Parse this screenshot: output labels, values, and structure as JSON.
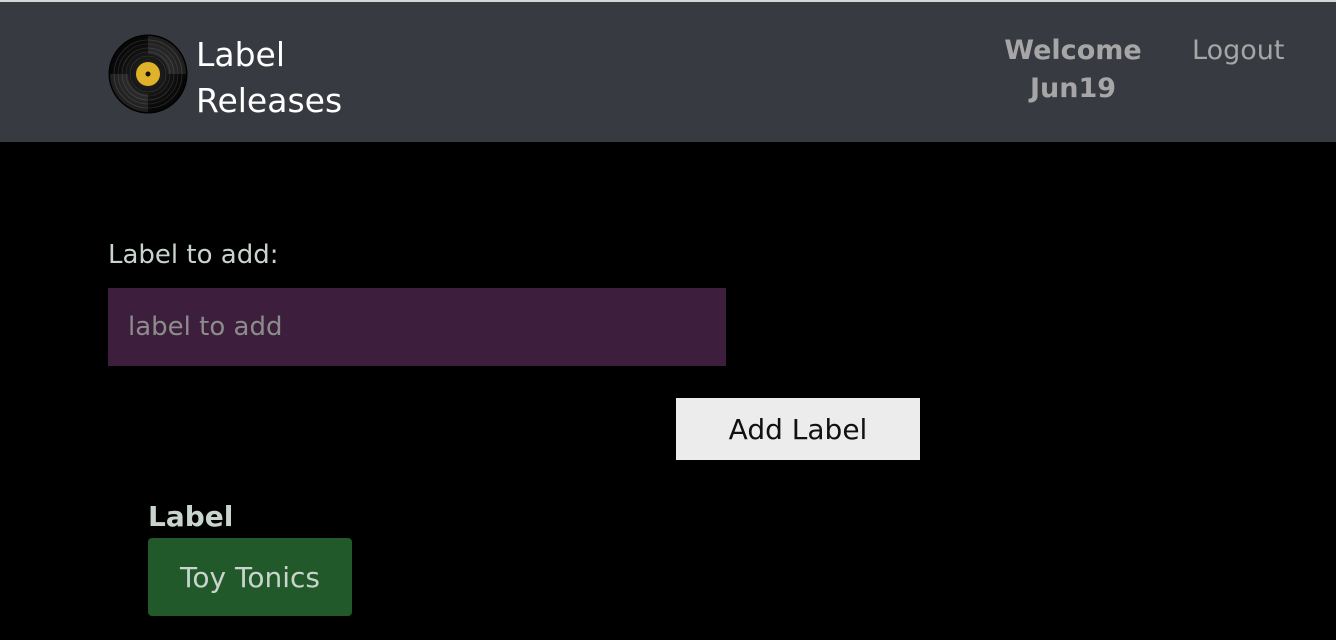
{
  "header": {
    "brand_line1": "Label",
    "brand_line2": "Releases",
    "logo_icon": "vinyl-record-icon",
    "welcome_line1": "Welcome",
    "welcome_line2": "Jun19",
    "logout_label": "Logout"
  },
  "form": {
    "label_text": "Label to add:",
    "input_value": "",
    "input_placeholder": "label to add",
    "button_label": "Add Label"
  },
  "labels": {
    "heading": "Label",
    "items": [
      "Toy Tonics"
    ]
  },
  "colors": {
    "navbar": "#373a41",
    "background": "#000000",
    "input_bg": "#3d1f3d",
    "chip_bg": "#22592a",
    "record_center": "#e0b22a"
  }
}
